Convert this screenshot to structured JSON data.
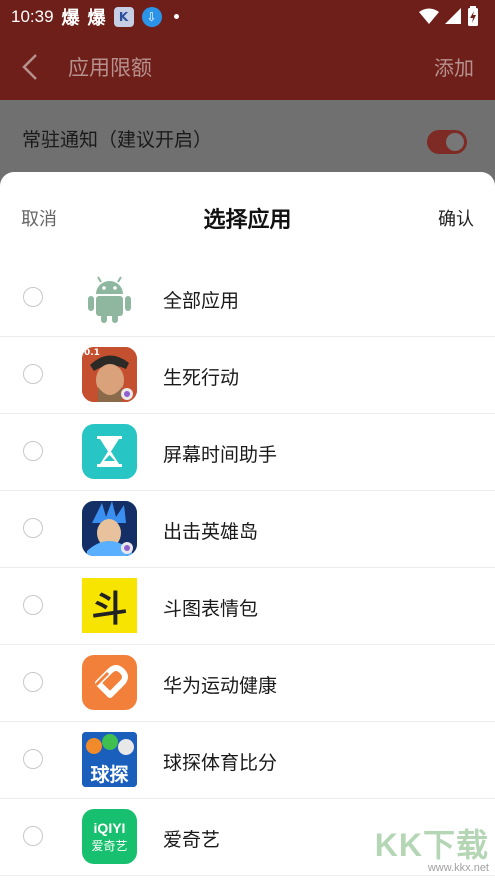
{
  "status_bar": {
    "time": "10:39",
    "glyph_1": "爆",
    "glyph_2": "爆",
    "box_glyph": "K",
    "download_glyph": "⇩"
  },
  "app_bar": {
    "title": "应用限额",
    "add_label": "添加"
  },
  "notice": {
    "label": "常驻通知（建议开启）",
    "enabled": true
  },
  "sheet": {
    "cancel_label": "取消",
    "title": "选择应用",
    "confirm_label": "确认"
  },
  "apps": [
    {
      "name": "全部应用",
      "icon": "android-icon"
    },
    {
      "name": "生死行动",
      "icon": "soldier-game-icon"
    },
    {
      "name": "屏幕时间助手",
      "icon": "hourglass-icon"
    },
    {
      "name": "出击英雄岛",
      "icon": "hero-game-icon"
    },
    {
      "name": "斗图表情包",
      "icon": "dou-character-icon"
    },
    {
      "name": "华为运动健康",
      "icon": "huawei-health-icon"
    },
    {
      "name": "球探体育比分",
      "icon": "sports-score-icon"
    },
    {
      "name": "爱奇艺",
      "icon": "iqiyi-icon"
    }
  ],
  "icon_texts": {
    "dou": "斗",
    "sports": "球探",
    "iqiyi_top": "iQIYI",
    "iqiyi_bottom": "爱奇艺",
    "game_badge": "0.1"
  },
  "watermark": {
    "big": "KK下载",
    "small": "www.kkx.net"
  },
  "colors": {
    "brand_red": "#c0362c",
    "toggle_on": "#c0362c",
    "hourglass_bg": "#27c5c3",
    "dou_bg": "#f7e400",
    "huawei_bg": "#f2803a",
    "iqiyi_bg": "#17c06e",
    "android_green": "#8fb7a0"
  }
}
